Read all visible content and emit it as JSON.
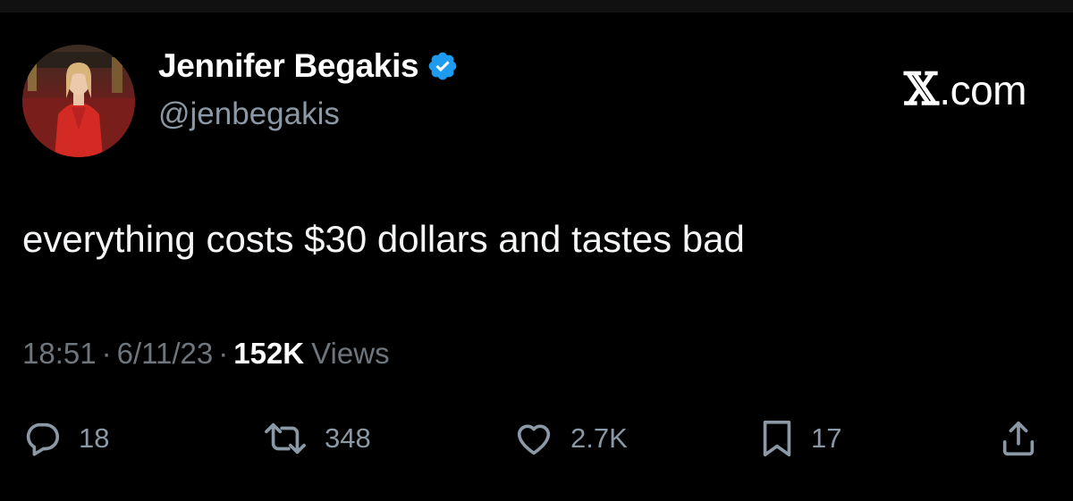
{
  "author": {
    "display_name": "Jennifer Begakis",
    "handle": "@jenbegakis",
    "verified": true,
    "avatar_icon": "profile-photo-woman-red-blazer"
  },
  "site_badge": {
    "mark": "𝕏",
    "suffix": ".com"
  },
  "tweet": {
    "text": "everything costs $30 dollars and tastes bad"
  },
  "meta": {
    "time": "18:51",
    "separator": "·",
    "date": "6/11/23",
    "views_count": "152K",
    "views_label": "Views"
  },
  "actions": {
    "reply": {
      "icon": "reply-icon",
      "count": "18"
    },
    "retweet": {
      "icon": "retweet-icon",
      "count": "348"
    },
    "like": {
      "icon": "heart-icon",
      "count": "2.7K"
    },
    "bookmark": {
      "icon": "bookmark-icon",
      "count": "17"
    },
    "share": {
      "icon": "share-icon"
    }
  },
  "colors": {
    "background": "#000000",
    "primary_text": "#ffffff",
    "secondary_text": "#8b98a5",
    "verified_blue": "#1d9bf0"
  }
}
